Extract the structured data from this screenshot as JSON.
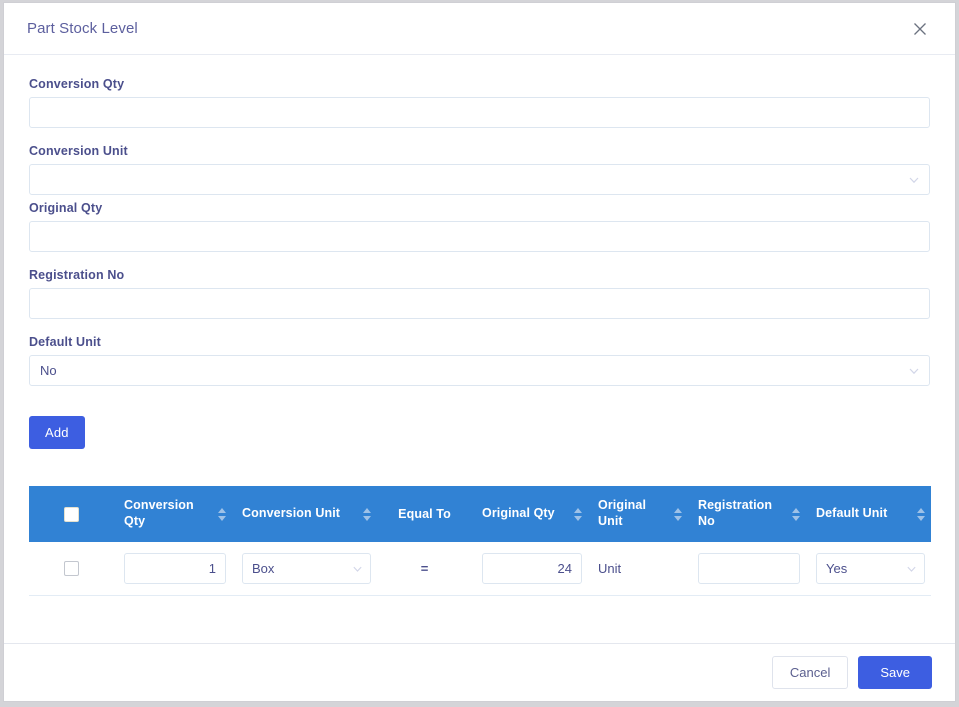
{
  "dialog": {
    "title": "Part Stock Level",
    "close_icon": "close-icon"
  },
  "colors": {
    "primary_button": "#3d5ee1",
    "table_header": "#3182d4",
    "label_text": "#4b4f8c",
    "title_text": "#5c5f9e",
    "input_border": "#dde6f0"
  },
  "form": {
    "conversion_qty": {
      "label": "Conversion Qty",
      "value": "",
      "placeholder": ""
    },
    "conversion_unit": {
      "label": "Conversion Unit",
      "value": "",
      "chevron": "chevron-down-icon"
    },
    "original_qty": {
      "label": "Original Qty",
      "value": "",
      "placeholder": ""
    },
    "registration_no": {
      "label": "Registration No",
      "value": "",
      "placeholder": ""
    },
    "default_unit": {
      "label": "Default Unit",
      "value": "No",
      "chevron": "chevron-down-icon"
    },
    "add_button": "Add"
  },
  "table": {
    "columns": [
      {
        "key": "select",
        "label": "",
        "sortable": false
      },
      {
        "key": "conversion_qty",
        "label": "Conversion Qty",
        "sortable": true
      },
      {
        "key": "conversion_unit",
        "label": "Conversion Unit",
        "sortable": true
      },
      {
        "key": "equal_to",
        "label": "Equal To",
        "sortable": false
      },
      {
        "key": "original_qty",
        "label": "Original Qty",
        "sortable": true
      },
      {
        "key": "original_unit",
        "label": "Original Unit",
        "sortable": true
      },
      {
        "key": "registration_no",
        "label": "Registration No",
        "sortable": true
      },
      {
        "key": "default_unit",
        "label": "Default Unit",
        "sortable": true
      }
    ],
    "header_checkbox_checked": false,
    "rows": [
      {
        "selected": false,
        "conversion_qty": "1",
        "conversion_unit": "Box",
        "equal_to": "=",
        "original_qty": "24",
        "original_unit": "Unit",
        "registration_no": "",
        "default_unit": "Yes"
      }
    ]
  },
  "footer": {
    "cancel_label": "Cancel",
    "save_label": "Save"
  }
}
